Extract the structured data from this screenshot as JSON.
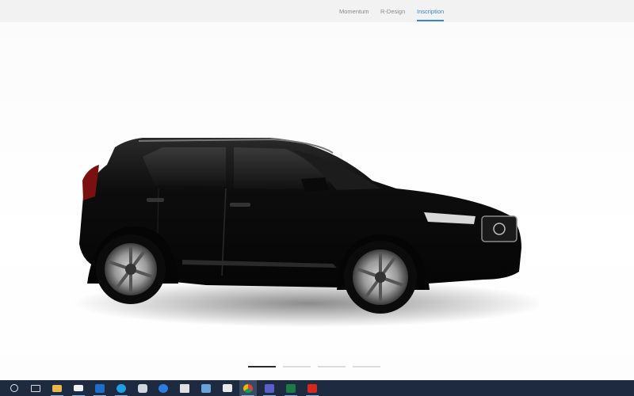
{
  "trim_tabs": [
    {
      "label": "Momentum",
      "active": false
    },
    {
      "label": "R-Design",
      "active": false
    },
    {
      "label": "Inscription",
      "active": true
    }
  ],
  "colors": {
    "accent": "#3a84c9",
    "car_paint": "#0c0c0c",
    "taskbar_bg": "#1d2a3f"
  },
  "carousel": {
    "slide_count": 4,
    "active_index": 0
  },
  "taskbar": {
    "items": [
      {
        "icon": "start-circle-icon"
      },
      {
        "icon": "task-view-icon"
      },
      {
        "icon": "file-explorer-icon"
      },
      {
        "icon": "mail-icon"
      },
      {
        "icon": "outlook-icon"
      },
      {
        "icon": "skype-icon"
      },
      {
        "icon": "edge-icon"
      },
      {
        "icon": "settings-app-icon"
      },
      {
        "icon": "remote-desktop-icon"
      },
      {
        "icon": "store-icon"
      },
      {
        "icon": "chrome-icon"
      },
      {
        "icon": "teams-icon"
      },
      {
        "icon": "excel-icon"
      },
      {
        "icon": "acrobat-icon"
      }
    ]
  }
}
